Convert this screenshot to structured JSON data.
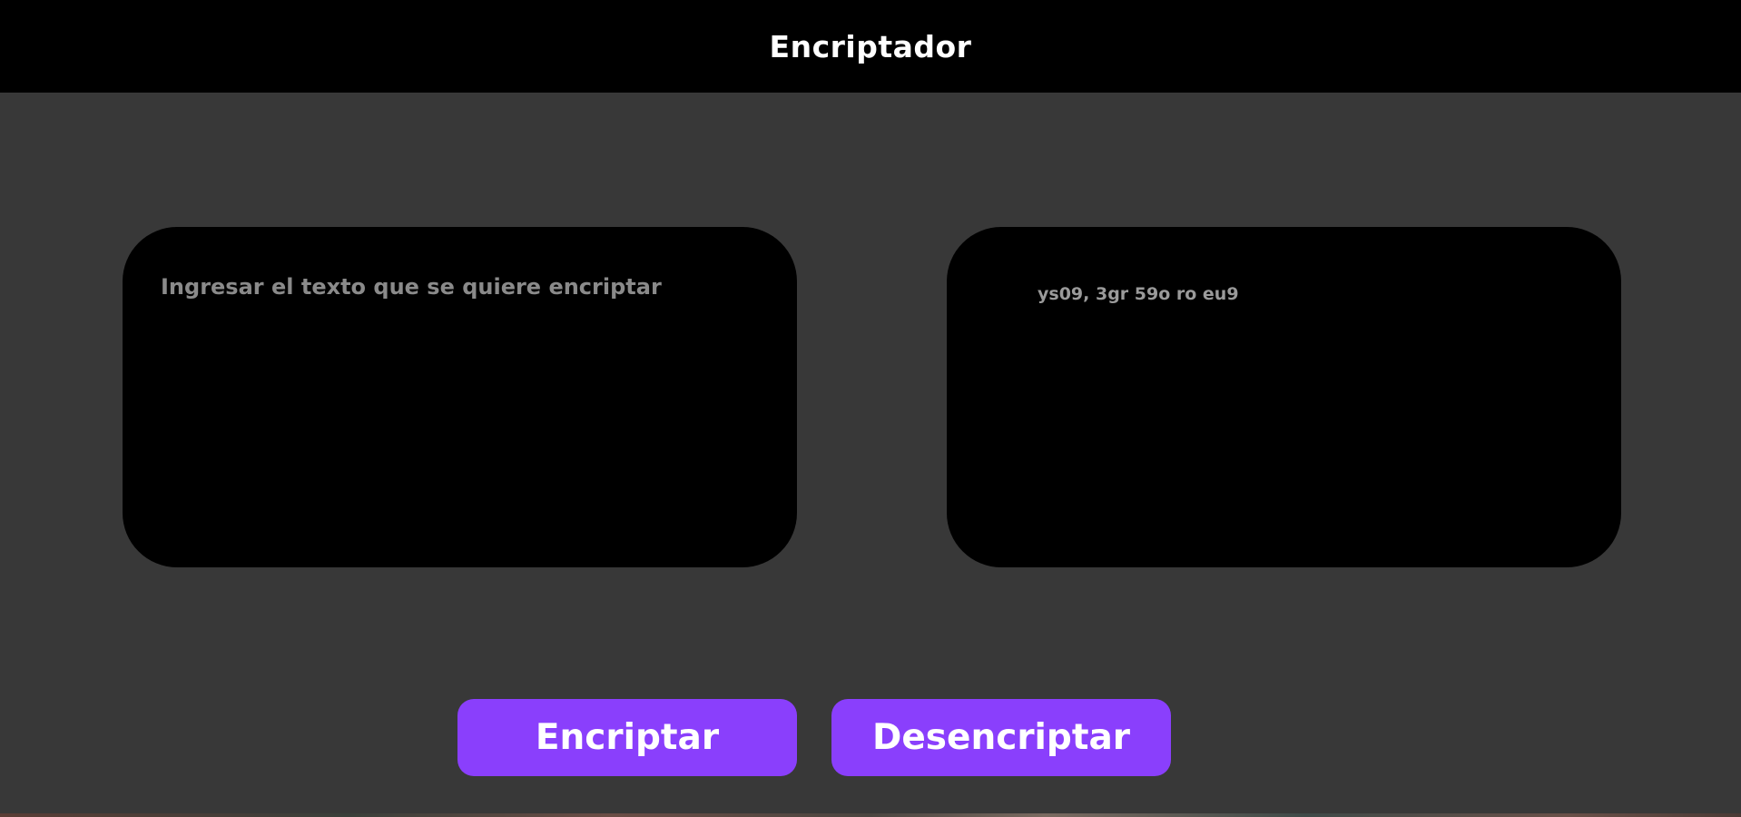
{
  "header": {
    "title": "Encriptador"
  },
  "input": {
    "placeholder": "Ingresar el texto que se quiere encriptar",
    "value": ""
  },
  "output": {
    "text": "ys09, 3gr 59o ro eu9"
  },
  "buttons": {
    "encrypt_label": "Encriptar",
    "decrypt_label": "Desencriptar"
  },
  "colors": {
    "header_bg": "#000000",
    "page_bg": "#383838",
    "panel_bg": "#000000",
    "button_bg": "#8a3ffc",
    "button_text": "#ffffff"
  }
}
